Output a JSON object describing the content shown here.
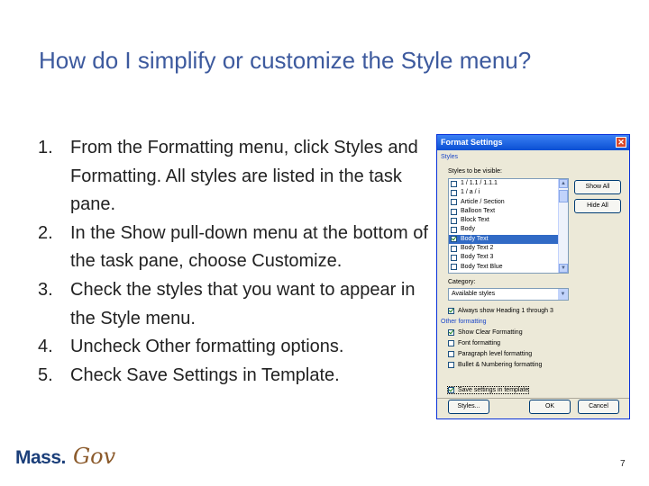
{
  "slide": {
    "title": "How do I simplify or customize the Style menu?",
    "steps": [
      {
        "num": "1.",
        "text": "From the Formatting menu, click Styles and Formatting.  All styles are listed in the task pane."
      },
      {
        "num": "2.",
        "text": "In the Show pull-down menu at the bottom of the task pane, choose Customize."
      },
      {
        "num": "3.",
        "text": "Check the styles that you want to appear in the Style menu."
      },
      {
        "num": "4.",
        "text": "Uncheck Other formatting options."
      },
      {
        "num": "5.",
        "text": "Check Save Settings in Template."
      }
    ],
    "page_number": "7",
    "logo": {
      "mass": "Mass.",
      "gov": "Gov"
    }
  },
  "dialog": {
    "title": "Format Settings",
    "close_glyph": "✕",
    "styles_group_label": "Styles",
    "styles_visible_label": "Styles to be visible:",
    "styles_list": [
      {
        "label": "1 / 1.1 / 1.1.1",
        "checked": false,
        "selected": false
      },
      {
        "label": "1 / a / i",
        "checked": false,
        "selected": false
      },
      {
        "label": "Article / Section",
        "checked": false,
        "selected": false
      },
      {
        "label": "Balloon Text",
        "checked": false,
        "selected": false
      },
      {
        "label": "Block Text",
        "checked": false,
        "selected": false
      },
      {
        "label": "Body",
        "checked": false,
        "selected": false
      },
      {
        "label": "Body Text",
        "checked": true,
        "selected": true
      },
      {
        "label": "Body Text 2",
        "checked": false,
        "selected": false
      },
      {
        "label": "Body Text 3",
        "checked": false,
        "selected": false
      },
      {
        "label": "Body Text Blue",
        "checked": false,
        "selected": false
      }
    ],
    "show_all_label": "Show All",
    "hide_all_label": "Hide All",
    "category_label": "Category:",
    "category_value": "Available styles",
    "always_show_label": "Always show Heading 1 through 3",
    "other_formatting_group_label": "Other formatting",
    "other_formatting": [
      {
        "label": "Show Clear Formatting",
        "checked": true
      },
      {
        "label": "Font formatting",
        "checked": false
      },
      {
        "label": "Paragraph level formatting",
        "checked": false
      },
      {
        "label": "Bullet & Numbering formatting",
        "checked": false
      }
    ],
    "save_settings_label": "Save settings in template",
    "save_settings_checked": true,
    "always_show_checked": true,
    "styles_button": "Styles...",
    "ok_button": "OK",
    "cancel_button": "Cancel",
    "colors": {
      "accent": "#3d5a9e",
      "selection": "#316ac5",
      "titlebar": "#0a4fd4"
    }
  }
}
